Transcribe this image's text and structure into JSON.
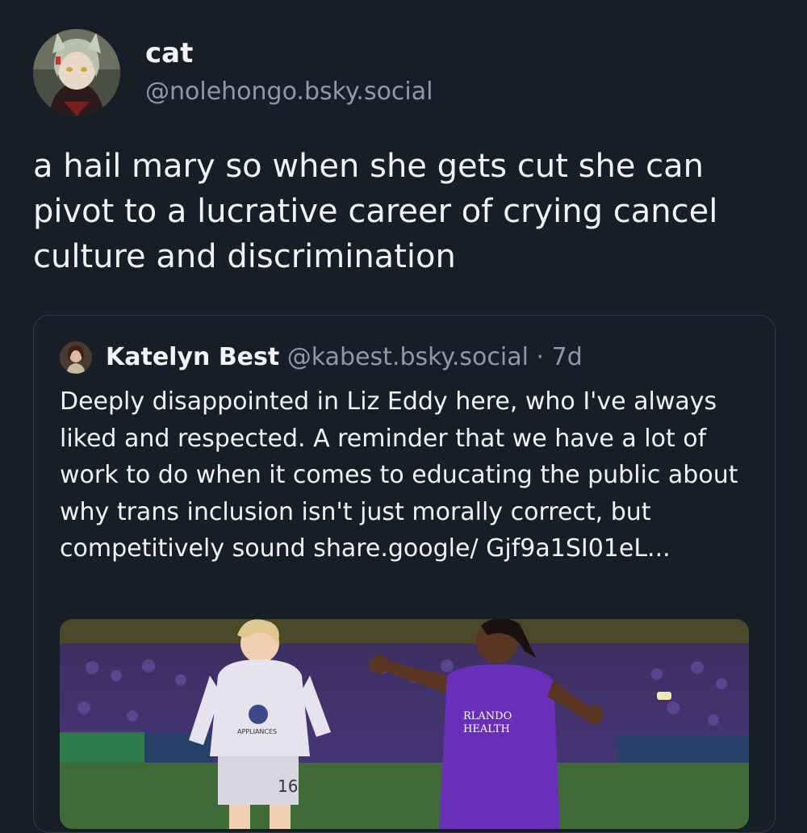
{
  "post": {
    "author_name": "cat",
    "author_handle": "@nolehongo.bsky.social",
    "text": "a hail mary so when she gets cut she can pivot to a lucrative career of crying cancel culture and discrimination"
  },
  "quote": {
    "author_name": "Katelyn Best",
    "author_handle": "@kabest.bsky.social",
    "separator": "·",
    "time": "7d",
    "text": "Deeply disappointed in Liz Eddy here, who I've always liked and respected. A reminder that we have a lot of work to do when it comes to educating the public about why trans inclusion isn't just morally correct, but competitively sound share.google/ Gjf9a1SI01eL...",
    "image": {
      "kit_text_line1": "RLANDO",
      "kit_text_line2": "HEALTH",
      "sponsor_text": "APPLIANCES",
      "shirt_number": "16"
    }
  },
  "colors": {
    "background": "#161e27",
    "text_primary": "#f1f3f5",
    "text_secondary": "#8d9aa9",
    "border": "#2e3a48",
    "kit_purple": "#6a2fb8"
  }
}
